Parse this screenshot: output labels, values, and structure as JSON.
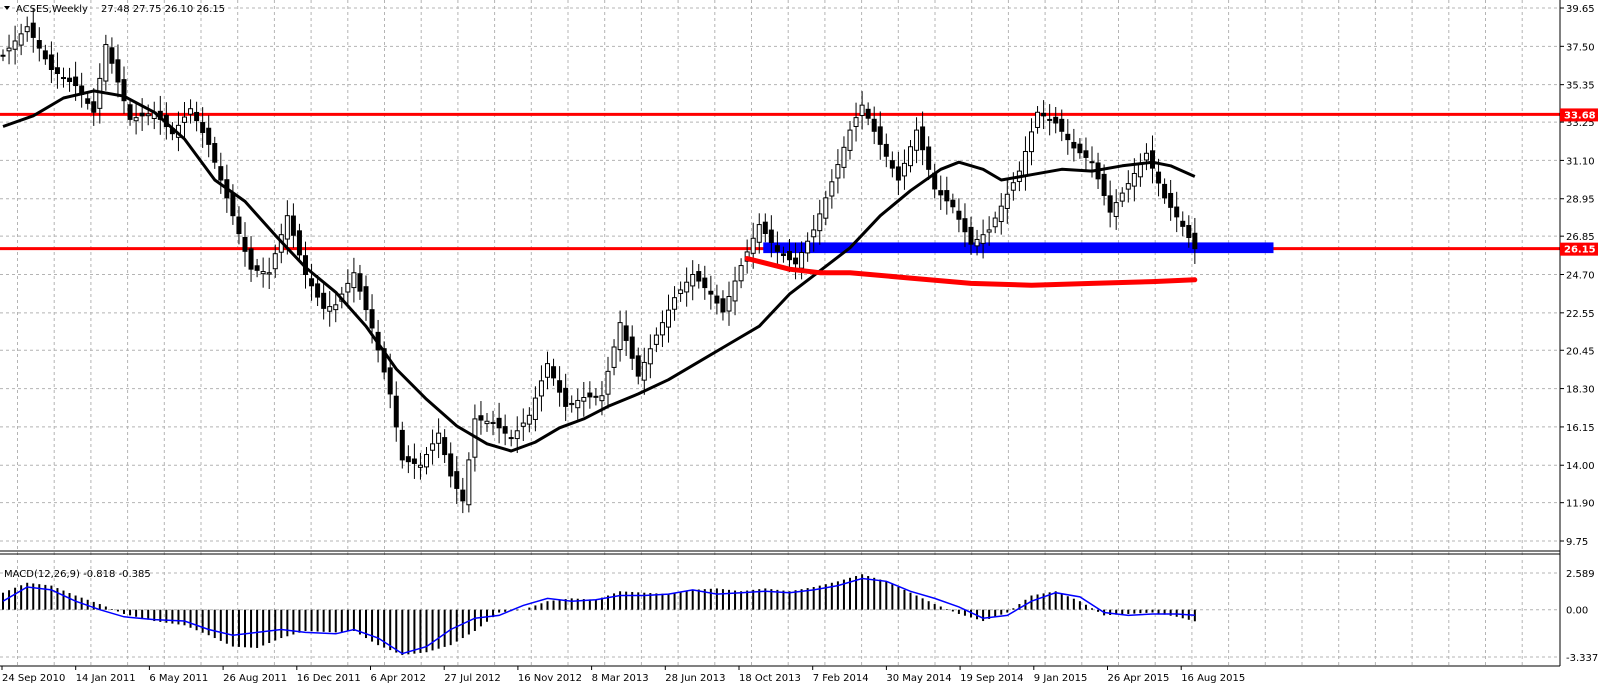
{
  "chart_data": {
    "type": "candlestick",
    "symbol_header": "ACSES,Weekly",
    "ohlc_header": "27.48 27.75 26.10 26.15",
    "menu_icon": "triangle-down-icon",
    "colors": {
      "background": "#ffffff",
      "grid": "#b4b4b4",
      "candles": "#000000",
      "level_lines": "#ff0000",
      "zone": "#0000ff",
      "ma": "#000000",
      "macd_histogram": "#000000",
      "macd_signal": "#0000ff",
      "price_tag": "#ff0000"
    },
    "price_axis": {
      "ticks": [
        "39.65",
        "37.50",
        "35.35",
        "33.25",
        "31.10",
        "28.95",
        "26.85",
        "24.70",
        "22.55",
        "20.45",
        "18.30",
        "16.15",
        "14.00",
        "11.90",
        "9.75"
      ],
      "range": [
        9.75,
        39.65
      ]
    },
    "time_axis": {
      "labels": [
        "24 Sep 2010",
        "14 Jan 2011",
        "6 May 2011",
        "26 Aug 2011",
        "16 Dec 2011",
        "6 Apr 2012",
        "27 Jul 2012",
        "16 Nov 2012",
        "8 Mar 2013",
        "28 Jun 2013",
        "18 Oct 2013",
        "7 Feb 2014",
        "30 May 2014",
        "19 Sep 2014",
        "9 Jan 2015",
        "26 Apr 2015",
        "16 Aug 2015"
      ]
    },
    "price_path": [
      [
        0,
        37.0
      ],
      [
        4,
        38.6
      ],
      [
        8,
        36.2
      ],
      [
        12,
        35.3
      ],
      [
        15,
        33.8
      ],
      [
        17,
        37.6
      ],
      [
        21,
        33.4
      ],
      [
        25,
        33.8
      ],
      [
        28,
        32.6
      ],
      [
        31,
        34.0
      ],
      [
        34,
        32.0
      ],
      [
        36,
        30.0
      ],
      [
        39,
        27.0
      ],
      [
        41,
        25.0
      ],
      [
        44,
        24.8
      ],
      [
        47,
        28.0
      ],
      [
        50,
        24.7
      ],
      [
        53,
        22.8
      ],
      [
        55,
        23.0
      ],
      [
        58,
        24.8
      ],
      [
        61,
        21.7
      ],
      [
        64,
        18.0
      ],
      [
        66,
        14.3
      ],
      [
        69,
        14.0
      ],
      [
        72,
        15.8
      ],
      [
        74,
        13.4
      ],
      [
        76,
        12.0
      ],
      [
        78,
        16.6
      ],
      [
        81,
        16.4
      ],
      [
        84,
        15.5
      ],
      [
        87,
        16.8
      ],
      [
        90,
        19.7
      ],
      [
        93,
        17.3
      ],
      [
        96,
        17.8
      ],
      [
        99,
        17.9
      ],
      [
        102,
        22.0
      ],
      [
        105,
        19.0
      ],
      [
        108,
        21.3
      ],
      [
        111,
        23.4
      ],
      [
        114,
        24.7
      ],
      [
        117,
        23.6
      ],
      [
        119,
        22.6
      ],
      [
        122,
        25.2
      ],
      [
        125,
        27.5
      ],
      [
        128,
        26.0
      ],
      [
        131,
        25.3
      ],
      [
        134,
        27.2
      ],
      [
        137,
        29.9
      ],
      [
        140,
        32.8
      ],
      [
        142,
        34.2
      ],
      [
        145,
        32.0
      ],
      [
        148,
        30.0
      ],
      [
        151,
        32.8
      ],
      [
        154,
        29.5
      ],
      [
        157,
        28.5
      ],
      [
        160,
        26.4
      ],
      [
        163,
        27.2
      ],
      [
        166,
        29.2
      ],
      [
        168,
        30.5
      ],
      [
        171,
        33.8
      ],
      [
        174,
        33.2
      ],
      [
        177,
        31.8
      ],
      [
        180,
        31.0
      ],
      [
        183,
        28.2
      ],
      [
        186,
        29.8
      ],
      [
        189,
        31.5
      ],
      [
        192,
        29.0
      ],
      [
        195,
        27.4
      ],
      [
        197,
        26.15
      ]
    ],
    "ma_path": [
      [
        0,
        33.0
      ],
      [
        5,
        33.6
      ],
      [
        10,
        34.6
      ],
      [
        15,
        35.0
      ],
      [
        20,
        34.7
      ],
      [
        25,
        33.8
      ],
      [
        30,
        32.3
      ],
      [
        35,
        30.0
      ],
      [
        40,
        28.8
      ],
      [
        45,
        26.9
      ],
      [
        50,
        25.1
      ],
      [
        55,
        23.7
      ],
      [
        60,
        21.8
      ],
      [
        65,
        19.4
      ],
      [
        70,
        17.7
      ],
      [
        75,
        16.2
      ],
      [
        80,
        15.2
      ],
      [
        84,
        14.8
      ],
      [
        88,
        15.3
      ],
      [
        92,
        16.1
      ],
      [
        96,
        16.6
      ],
      [
        100,
        17.3
      ],
      [
        105,
        18.0
      ],
      [
        110,
        18.8
      ],
      [
        115,
        19.8
      ],
      [
        120,
        20.8
      ],
      [
        125,
        21.8
      ],
      [
        130,
        23.6
      ],
      [
        135,
        24.9
      ],
      [
        140,
        26.2
      ],
      [
        145,
        28.0
      ],
      [
        150,
        29.4
      ],
      [
        155,
        30.6
      ],
      [
        158,
        31.0
      ],
      [
        162,
        30.6
      ],
      [
        165,
        30.0
      ],
      [
        170,
        30.3
      ],
      [
        175,
        30.6
      ],
      [
        180,
        30.5
      ],
      [
        185,
        30.8
      ],
      [
        190,
        31.0
      ],
      [
        193,
        30.8
      ],
      [
        197,
        30.2
      ]
    ],
    "ma_label": "",
    "horizontal_levels": [
      {
        "price": 33.68,
        "label": "33.68",
        "style": "red-line"
      },
      {
        "price": 26.15,
        "label": "26.15",
        "style": "red-line"
      }
    ],
    "support_zone": {
      "from_week": 125,
      "to_week": 210,
      "price_low": 25.9,
      "price_high": 26.5,
      "style": "blue-band"
    },
    "red_curve_path": [
      [
        123,
        25.6
      ],
      [
        130,
        25.0
      ],
      [
        135,
        24.8
      ],
      [
        140,
        24.8
      ],
      [
        150,
        24.5
      ],
      [
        160,
        24.2
      ],
      [
        170,
        24.1
      ],
      [
        180,
        24.2
      ],
      [
        190,
        24.3
      ],
      [
        197,
        24.4
      ]
    ],
    "macd": {
      "header": "MACD(12,26,9) -0.818 -0.385",
      "axis_ticks": [
        "2.589",
        "0.00",
        "-3.337"
      ],
      "range": [
        -3.337,
        2.589
      ],
      "histogram_path": [
        [
          0,
          1.2
        ],
        [
          4,
          1.9
        ],
        [
          8,
          1.7
        ],
        [
          12,
          1.0
        ],
        [
          16,
          0.4
        ],
        [
          20,
          -0.3
        ],
        [
          25,
          -0.8
        ],
        [
          30,
          -1.1
        ],
        [
          34,
          -1.8
        ],
        [
          38,
          -2.6
        ],
        [
          42,
          -2.7
        ],
        [
          46,
          -2.0
        ],
        [
          50,
          -1.5
        ],
        [
          55,
          -1.6
        ],
        [
          58,
          -1.5
        ],
        [
          62,
          -2.5
        ],
        [
          66,
          -3.2
        ],
        [
          70,
          -3.0
        ],
        [
          74,
          -2.5
        ],
        [
          78,
          -1.5
        ],
        [
          82,
          -0.2
        ],
        [
          86,
          0.0
        ],
        [
          90,
          0.6
        ],
        [
          94,
          0.8
        ],
        [
          98,
          0.7
        ],
        [
          102,
          1.3
        ],
        [
          106,
          1.2
        ],
        [
          110,
          1.1
        ],
        [
          114,
          1.4
        ],
        [
          118,
          1.5
        ],
        [
          122,
          1.3
        ],
        [
          126,
          1.5
        ],
        [
          130,
          1.3
        ],
        [
          134,
          1.6
        ],
        [
          138,
          2.0
        ],
        [
          142,
          2.5
        ],
        [
          146,
          2.0
        ],
        [
          150,
          1.2
        ],
        [
          154,
          0.4
        ],
        [
          158,
          -0.3
        ],
        [
          162,
          -0.8
        ],
        [
          166,
          -0.2
        ],
        [
          170,
          1.0
        ],
        [
          174,
          1.3
        ],
        [
          178,
          0.6
        ],
        [
          182,
          -0.4
        ],
        [
          186,
          -0.3
        ],
        [
          190,
          -0.2
        ],
        [
          194,
          -0.5
        ],
        [
          197,
          -0.818
        ]
      ],
      "signal_path": [
        [
          0,
          0.6
        ],
        [
          4,
          1.6
        ],
        [
          8,
          1.4
        ],
        [
          12,
          0.6
        ],
        [
          16,
          0.0
        ],
        [
          20,
          -0.5
        ],
        [
          25,
          -0.7
        ],
        [
          30,
          -0.8
        ],
        [
          34,
          -1.4
        ],
        [
          38,
          -1.8
        ],
        [
          42,
          -1.6
        ],
        [
          46,
          -1.4
        ],
        [
          50,
          -1.6
        ],
        [
          55,
          -1.7
        ],
        [
          58,
          -1.4
        ],
        [
          62,
          -2.0
        ],
        [
          66,
          -3.1
        ],
        [
          70,
          -2.6
        ],
        [
          74,
          -1.4
        ],
        [
          78,
          -0.6
        ],
        [
          82,
          -0.4
        ],
        [
          86,
          0.3
        ],
        [
          90,
          0.8
        ],
        [
          94,
          0.6
        ],
        [
          98,
          0.7
        ],
        [
          102,
          1.0
        ],
        [
          106,
          1.0
        ],
        [
          110,
          1.1
        ],
        [
          114,
          1.4
        ],
        [
          118,
          1.1
        ],
        [
          122,
          1.2
        ],
        [
          126,
          1.3
        ],
        [
          130,
          1.2
        ],
        [
          134,
          1.4
        ],
        [
          138,
          1.7
        ],
        [
          142,
          2.2
        ],
        [
          146,
          2.0
        ],
        [
          150,
          1.3
        ],
        [
          154,
          0.8
        ],
        [
          158,
          0.2
        ],
        [
          162,
          -0.6
        ],
        [
          166,
          -0.4
        ],
        [
          170,
          0.6
        ],
        [
          174,
          1.2
        ],
        [
          178,
          0.9
        ],
        [
          182,
          -0.2
        ],
        [
          186,
          -0.4
        ],
        [
          190,
          -0.3
        ],
        [
          194,
          -0.3
        ],
        [
          197,
          -0.385
        ]
      ]
    }
  }
}
